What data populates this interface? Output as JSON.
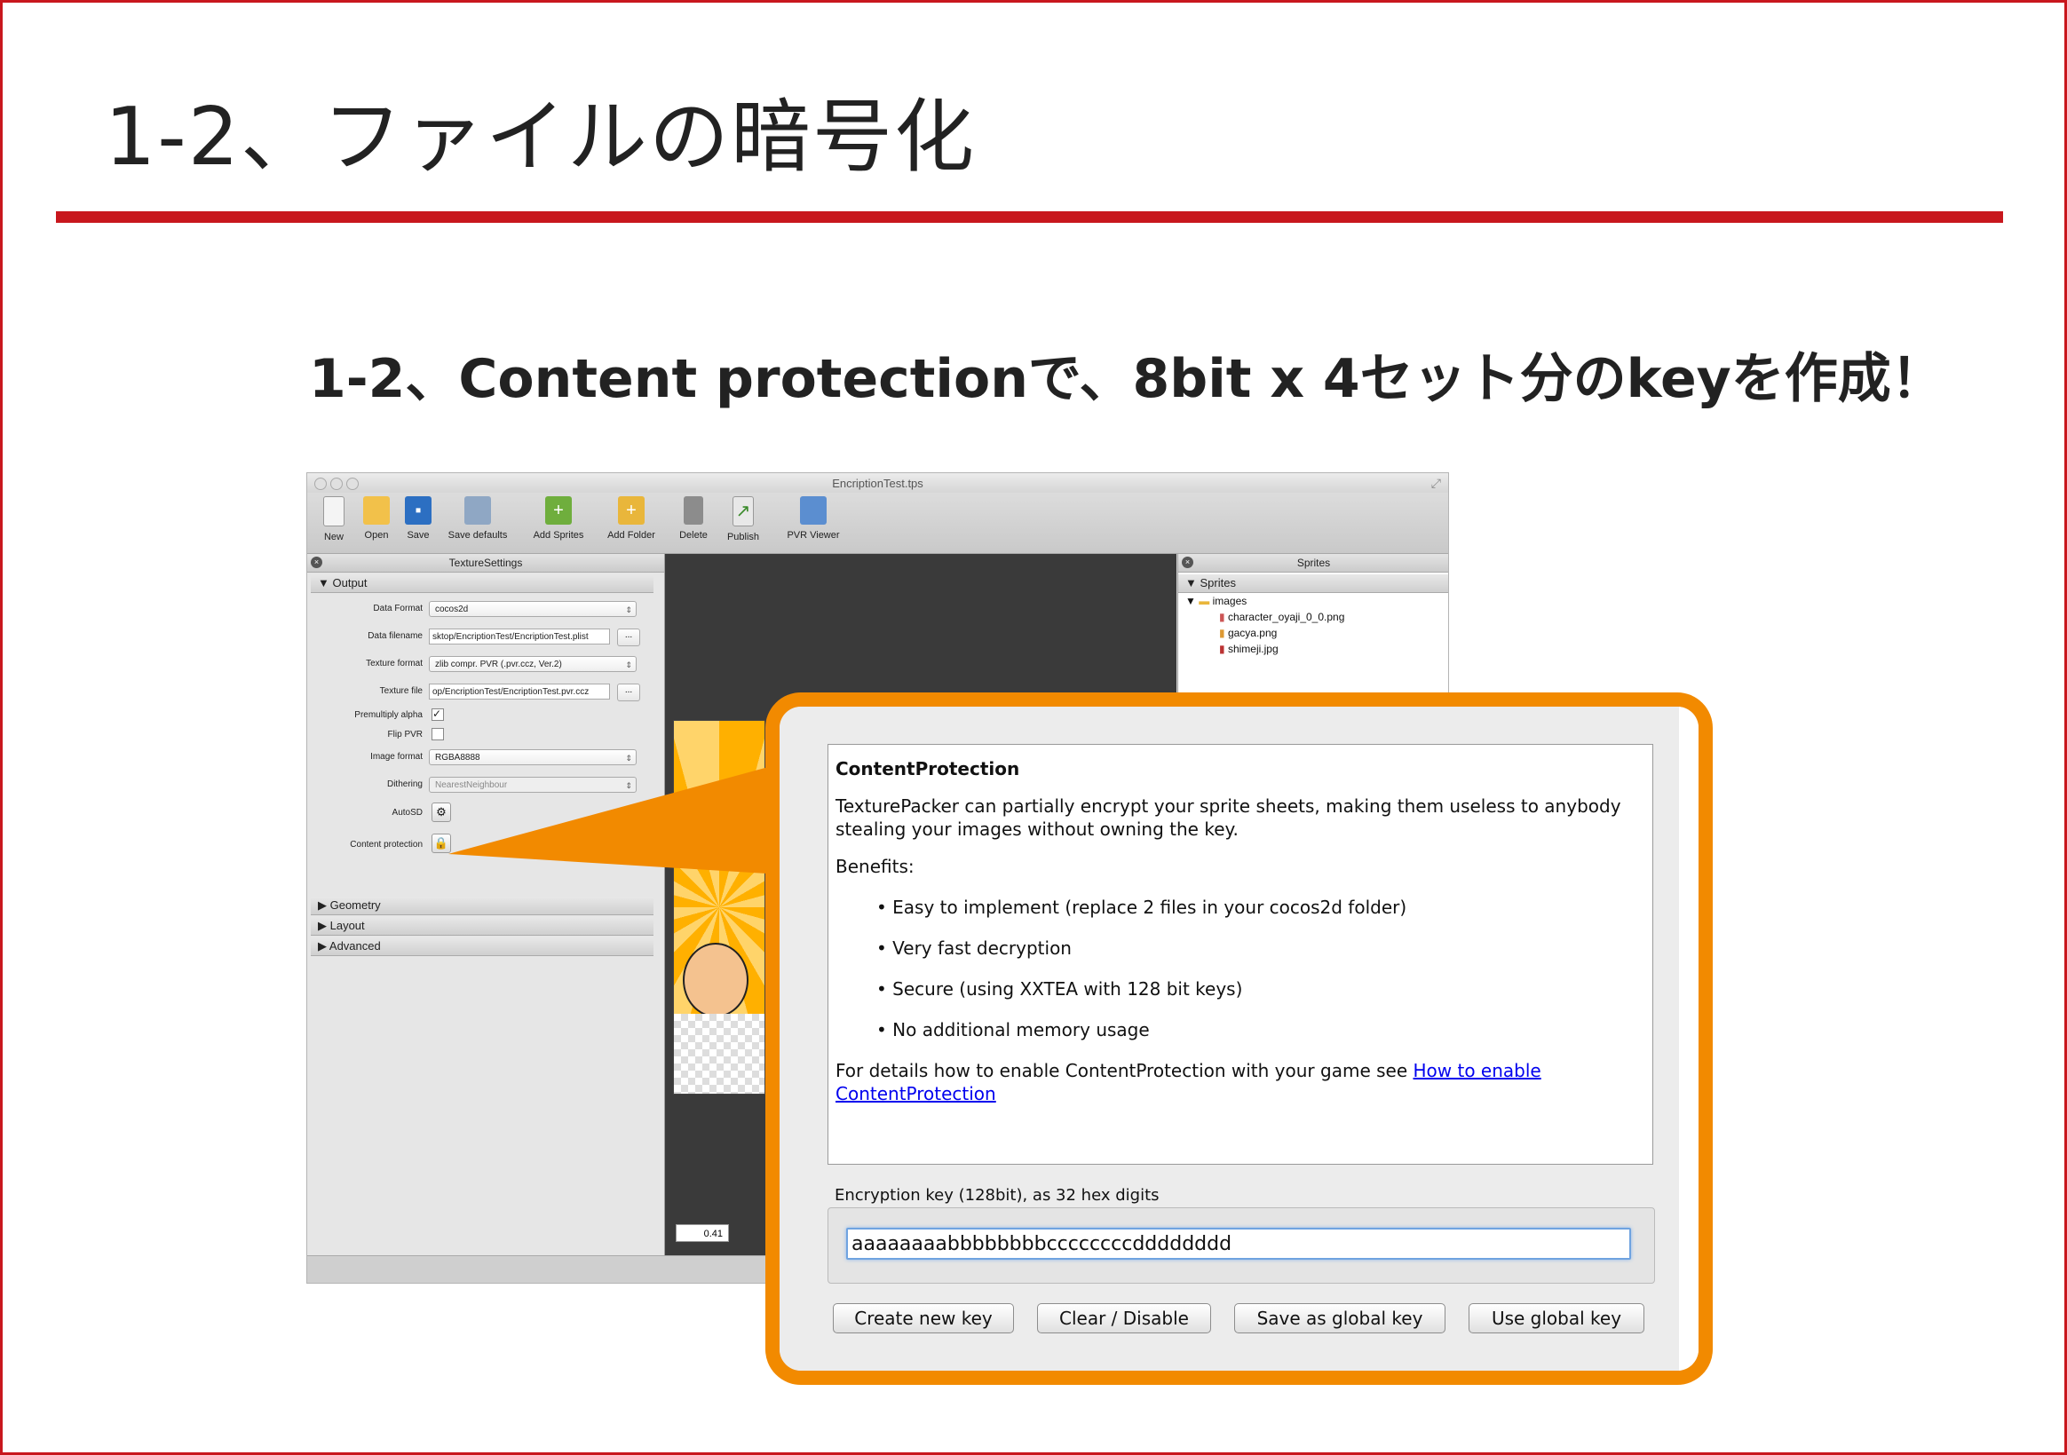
{
  "slide": {
    "title": "1-2、ファイルの暗号化",
    "subtitle": "1-2、Content protectionで、8bit x 4セット分のkeyを作成！",
    "accent_color": "#c8171d",
    "callout_color": "#f28a00"
  },
  "window": {
    "title": "EncriptionTest.tps",
    "toolbar": [
      {
        "label": "New",
        "icon": "new-document-icon"
      },
      {
        "label": "Open",
        "icon": "folder-icon"
      },
      {
        "label": "Save",
        "icon": "floppy-disk-icon"
      },
      {
        "label": "Save defaults",
        "icon": "save-defaults-icon"
      },
      {
        "label": "Add Sprites",
        "icon": "add-sprites-icon"
      },
      {
        "label": "Add Folder",
        "icon": "add-folder-icon"
      },
      {
        "label": "Delete",
        "icon": "trash-icon"
      },
      {
        "label": "Publish",
        "icon": "publish-icon"
      },
      {
        "label": "PVR Viewer",
        "icon": "pvr-viewer-icon"
      }
    ],
    "left_panel_title": "TextureSettings",
    "output_section": "Output",
    "fields": {
      "data_format_label": "Data Format",
      "data_format_value": "cocos2d",
      "data_filename_label": "Data filename",
      "data_filename_value": "sktop/EncriptionTest/EncriptionTest.plist",
      "texture_format_label": "Texture format",
      "texture_format_value": "zlib compr. PVR (.pvr.ccz, Ver.2)",
      "texture_file_label": "Texture file",
      "texture_file_value": "op/EncriptionTest/EncriptionTest.pvr.ccz",
      "premultiply_label": "Premultiply alpha",
      "flip_pvr_label": "Flip PVR",
      "image_format_label": "Image format",
      "image_format_value": "RGBA8888",
      "dithering_label": "Dithering",
      "dithering_value": "NearestNeighbour",
      "autosd_label": "AutoSD",
      "content_protection_label": "Content protection",
      "browse": "..."
    },
    "sections": [
      "Geometry",
      "Layout",
      "Advanced"
    ],
    "sprites_panel_title": "Sprites",
    "sprites_root": "Sprites",
    "sprites_folder": "images",
    "sprite_files": [
      "character_oyaji_0_0.png",
      "gacya.png",
      "shimeji.jpg"
    ],
    "zoom": "0.41"
  },
  "dialog": {
    "heading": "ContentProtection",
    "intro": "TexturePacker can partially encrypt your sprite sheets, making them useless to anybody stealing your images without owning the key.",
    "benefits_label": "Benefits:",
    "benefits": [
      "• Easy to implement (replace 2 files in your cocos2d folder)",
      "• Very fast decryption",
      "• Secure (using XXTEA with 128 bit keys)",
      "• No additional memory usage"
    ],
    "details_text": "For details how to enable ContentProtection with your game see ",
    "details_link": "How to enable ContentProtection",
    "key_label": "Encryption key (128bit), as 32 hex digits",
    "key_value": "aaaaaaaabbbbbbbbccccccccdddddddd",
    "buttons": {
      "create": "Create new key",
      "clear": "Clear / Disable",
      "save_global": "Save as global key",
      "use_global": "Use global key"
    }
  }
}
